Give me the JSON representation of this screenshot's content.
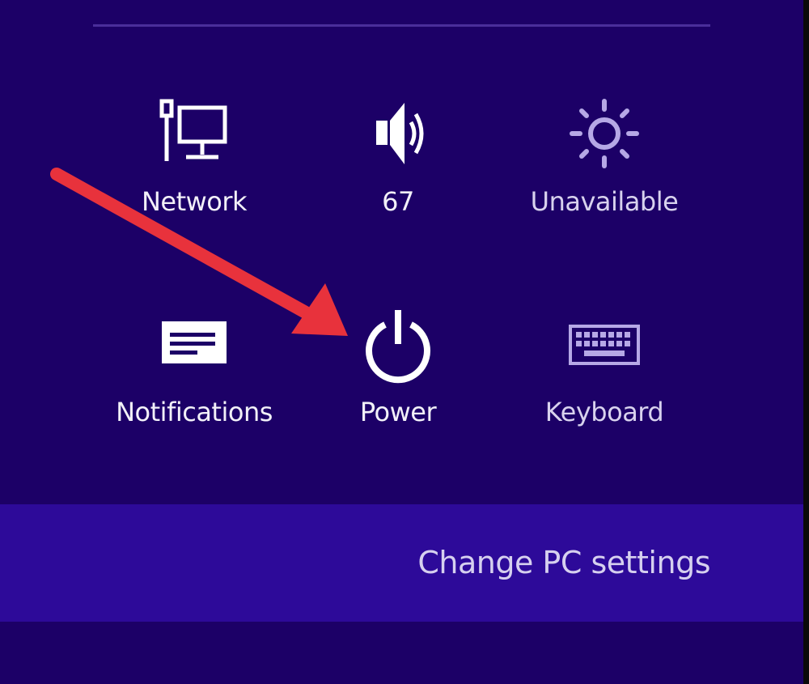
{
  "settings_pane": {
    "tiles": [
      {
        "id": "network",
        "label": "Network",
        "icon": "network-icon"
      },
      {
        "id": "volume",
        "label": "67",
        "icon": "speaker-icon"
      },
      {
        "id": "brightness",
        "label": "Unavailable",
        "icon": "brightness-icon"
      },
      {
        "id": "notifications",
        "label": "Notifications",
        "icon": "notifications-icon"
      },
      {
        "id": "power",
        "label": "Power",
        "icon": "power-icon"
      },
      {
        "id": "keyboard",
        "label": "Keyboard",
        "icon": "keyboard-icon"
      }
    ],
    "change_pc_settings": "Change PC settings"
  },
  "annotation": {
    "type": "arrow",
    "color": "#e8323c",
    "points_to": "power"
  },
  "colors": {
    "pane_background": "#1c0067",
    "settings_bar": "#2d0a99",
    "text": "#f2f0f8",
    "disabled_icon": "#b6a8e6"
  }
}
